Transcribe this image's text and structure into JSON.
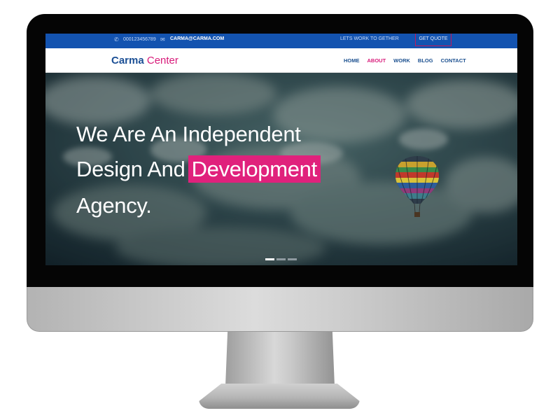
{
  "topbar": {
    "phone": "000123456789",
    "email": "CARMA@CARMA.COM",
    "tagline": "LETS WORK TO GETHER",
    "quote_button": "GET QUOTE",
    "phone_icon": "phone-icon",
    "mail_icon": "envelope-icon"
  },
  "brand": {
    "name_primary": "Carma",
    "name_secondary": "Center",
    "color_primary": "#1b4f95",
    "color_secondary": "#d81b7a"
  },
  "nav": {
    "items": [
      {
        "label": "HOME",
        "active": false
      },
      {
        "label": "ABOUT",
        "active": true
      },
      {
        "label": "WORK",
        "active": false
      },
      {
        "label": "BLOG",
        "active": false
      },
      {
        "label": "CONTACT",
        "active": false
      }
    ]
  },
  "hero": {
    "line1": "We Are An Independent",
    "line2_prefix": "Design And",
    "line2_highlight": "Development",
    "line3": "Agency.",
    "highlight_color": "#e0217c",
    "slides_total": 3,
    "active_slide": 1
  },
  "colors": {
    "topbar": "#1353b0",
    "accent": "#d81b7a"
  }
}
